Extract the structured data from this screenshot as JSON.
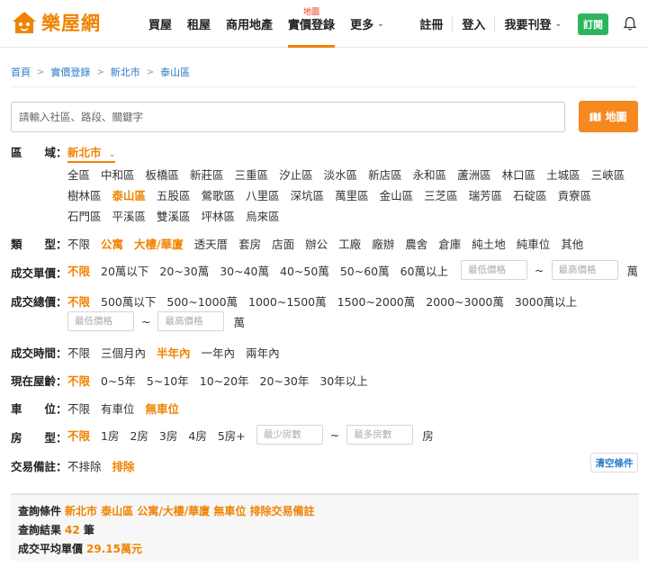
{
  "header": {
    "logo_text": "樂屋網",
    "nav": [
      {
        "label": "買屋"
      },
      {
        "label": "租屋"
      },
      {
        "label": "商用地產"
      },
      {
        "label": "實價登錄",
        "sup": "地圖",
        "active": true
      },
      {
        "label": "更多",
        "caret": true
      }
    ],
    "right": [
      {
        "label": "註冊"
      },
      {
        "label": "登入"
      },
      {
        "label": "我要刊登",
        "caret": true
      }
    ],
    "subscribe_label": "訂閱",
    "accent_color": "#f08300"
  },
  "breadcrumb": [
    "首頁",
    "實價登錄",
    "新北市",
    "泰山區"
  ],
  "search": {
    "placeholder": "請輸入社區、路段、關鍵字",
    "map_button": "地圖"
  },
  "filters": {
    "region": {
      "label": "區　　域：",
      "city": "新北市",
      "rows": [
        [
          "全區",
          "中和區",
          "板橋區",
          "新莊區",
          "三重區",
          "汐止區",
          "淡水區",
          "新店區",
          "永和區",
          "蘆洲區",
          "林口區",
          "土城區",
          "三峽區"
        ],
        [
          "樹林區",
          "泰山區",
          "五股區",
          "鶯歌區",
          "八里區",
          "深坑區",
          "萬里區",
          "金山區",
          "三芝區",
          "瑞芳區",
          "石碇區",
          "貢寮區"
        ],
        [
          "石門區",
          "平溪區",
          "雙溪區",
          "坪林區",
          "烏來區"
        ]
      ],
      "selected": "泰山區"
    },
    "type": {
      "label": "類　　型：",
      "options": [
        "不限",
        "公寓",
        "大樓/華廈",
        "透天厝",
        "套房",
        "店面",
        "辦公",
        "工廠",
        "廠辦",
        "農舍",
        "倉庫",
        "純土地",
        "純車位",
        "其他"
      ],
      "selected": [
        "公寓",
        "大樓/華廈"
      ]
    },
    "unit_price": {
      "label": "成交單價：",
      "options": [
        "不限",
        "20萬以下",
        "20~30萬",
        "30~40萬",
        "40~50萬",
        "50~60萬",
        "60萬以上"
      ],
      "selected": [
        "不限"
      ],
      "min_placeholder": "最低價格",
      "max_placeholder": "最高價格",
      "unit": "萬"
    },
    "total_price": {
      "label": "成交總價：",
      "options": [
        "不限",
        "500萬以下",
        "500~1000萬",
        "1000~1500萬",
        "1500~2000萬",
        "2000~3000萬",
        "3000萬以上"
      ],
      "selected": [
        "不限"
      ],
      "min_placeholder": "最低價格",
      "max_placeholder": "最高價格",
      "unit": "萬"
    },
    "deal_time": {
      "label": "成交時間：",
      "options": [
        "不限",
        "三個月內",
        "半年內",
        "一年內",
        "兩年內"
      ],
      "selected": [
        "半年內"
      ]
    },
    "age": {
      "label": "現在屋齡：",
      "options": [
        "不限",
        "0~5年",
        "5~10年",
        "10~20年",
        "20~30年",
        "30年以上"
      ],
      "selected": [
        "不限"
      ]
    },
    "parking": {
      "label": "車　　位：",
      "options": [
        "不限",
        "有車位",
        "無車位"
      ],
      "selected": [
        "無車位"
      ]
    },
    "rooms": {
      "label": "房　　型：",
      "options": [
        "不限",
        "1房",
        "2房",
        "3房",
        "4房",
        "5房+"
      ],
      "selected": [
        "不限"
      ],
      "min_placeholder": "最少房數",
      "max_placeholder": "最多房數",
      "unit": "房"
    },
    "remark": {
      "label": "交易備註：",
      "options": [
        "不排除",
        "排除"
      ],
      "selected": [
        "排除"
      ]
    },
    "clear_label": "清空條件"
  },
  "summary": {
    "cond_label": "查詢條件",
    "cond_value": "新北市 泰山區 公寓/大樓/華廈 無車位 排除交易備註",
    "result_label": "查詢結果",
    "result_count": "42",
    "result_unit": "筆",
    "avg_label": "成交平均單價",
    "avg_value": "29.15萬元"
  }
}
